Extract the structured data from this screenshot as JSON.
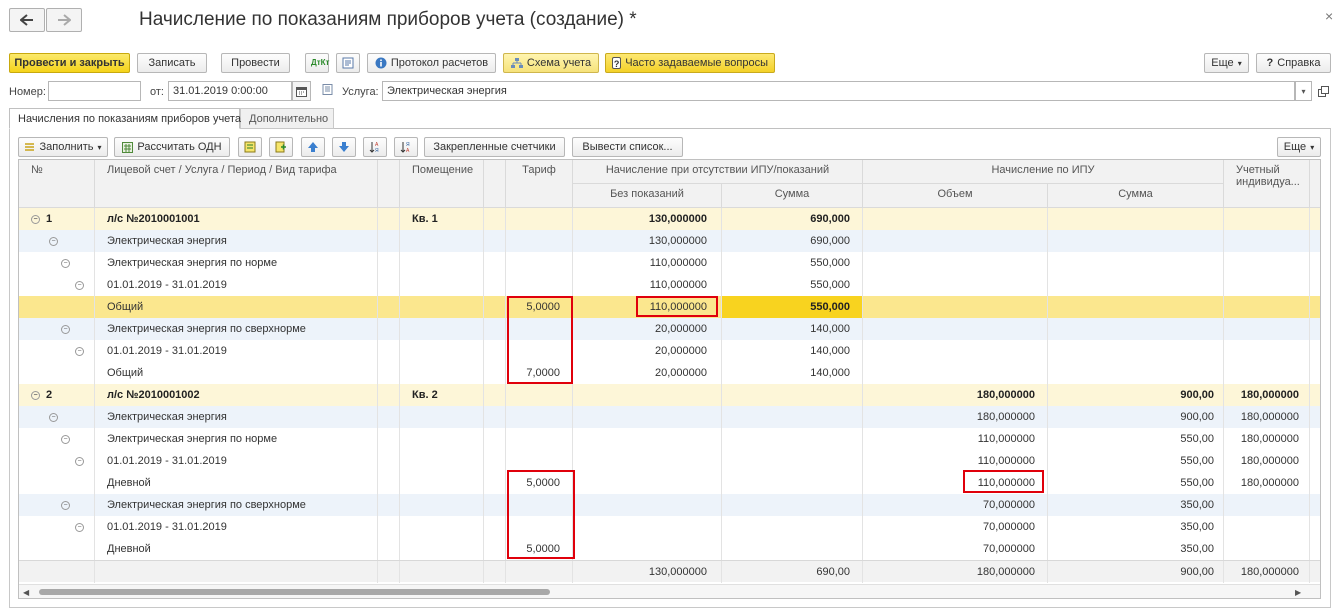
{
  "window": {
    "title": "Начисление по показаниям приборов учета (создание) *",
    "close_glyph": "×"
  },
  "toolbar": {
    "post_close": "Провести и закрыть",
    "save": "Записать",
    "post": "Провести",
    "protocol": "Протокол расчетов",
    "scheme": "Схема учета",
    "faq": "Часто задаваемые вопросы",
    "more": "Еще",
    "help": "Справка"
  },
  "form": {
    "number_label": "Номер:",
    "number_value": "",
    "date_label": "от:",
    "date_value": "31.01.2019  0:00:00",
    "service_label": "Услуга:",
    "service_value": "Электрическая энергия"
  },
  "tabs": [
    {
      "label": "Начисления по показаниям приборов учета"
    },
    {
      "label": "Дополнительно"
    }
  ],
  "table_toolbar": {
    "fill": "Заполнить",
    "calc": "Рассчитать ОДН",
    "fixed_meters": "Закрепленные счетчики",
    "output_list": "Вывести список...",
    "more": "Еще"
  },
  "columns": {
    "num": "№",
    "account": "Лицевой счет / Услуга / Период / Вид тарифа",
    "premises": "Помещение",
    "tariff": "Тариф",
    "no_ipu_group": "Начисление при отсутствии ИПУ/показаний",
    "no_readings": "Без показаний",
    "sum": "Сумма",
    "ipu_group": "Начисление по ИПУ",
    "volume": "Объем",
    "sum2": "Сумма",
    "individual": "Учетный индивидуа..."
  },
  "rows": [
    {
      "level": 0,
      "num": "1",
      "name": "л/с №2010001001",
      "premises": "Кв. 1",
      "tariff": "",
      "no_vol": "130,000000",
      "no_sum": "690,000",
      "ipu_vol": "",
      "ipu_sum": "",
      "ind": "",
      "style": "group"
    },
    {
      "level": 1,
      "num": "",
      "name": "Электрическая энергия",
      "premises": "",
      "tariff": "",
      "no_vol": "130,000000",
      "no_sum": "690,000",
      "ipu_vol": "",
      "ipu_sum": "",
      "ind": "",
      "style": "blue"
    },
    {
      "level": 2,
      "num": "",
      "name": "Электрическая энергия по норме",
      "premises": "",
      "tariff": "",
      "no_vol": "110,000000",
      "no_sum": "550,000",
      "ipu_vol": "",
      "ipu_sum": "",
      "ind": "",
      "style": "white"
    },
    {
      "level": 3,
      "num": "",
      "name": "01.01.2019 - 31.01.2019",
      "premises": "",
      "tariff": "",
      "no_vol": "110,000000",
      "no_sum": "550,000",
      "ipu_vol": "",
      "ipu_sum": "",
      "ind": "",
      "style": "white"
    },
    {
      "level": 4,
      "num": "",
      "name": "Общий",
      "premises": "",
      "tariff": "5,0000",
      "no_vol": "110,000000",
      "no_sum": "550,000",
      "ipu_vol": "",
      "ipu_sum": "",
      "ind": "",
      "style": "selected"
    },
    {
      "level": 2,
      "num": "",
      "name": "Электрическая энергия по сверхнорме",
      "premises": "",
      "tariff": "",
      "no_vol": "20,000000",
      "no_sum": "140,000",
      "ipu_vol": "",
      "ipu_sum": "",
      "ind": "",
      "style": "blue"
    },
    {
      "level": 3,
      "num": "",
      "name": "01.01.2019 - 31.01.2019",
      "premises": "",
      "tariff": "",
      "no_vol": "20,000000",
      "no_sum": "140,000",
      "ipu_vol": "",
      "ipu_sum": "",
      "ind": "",
      "style": "white"
    },
    {
      "level": 4,
      "num": "",
      "name": "Общий",
      "premises": "",
      "tariff": "7,0000",
      "no_vol": "20,000000",
      "no_sum": "140,000",
      "ipu_vol": "",
      "ipu_sum": "",
      "ind": "",
      "style": "white"
    },
    {
      "level": 0,
      "num": "2",
      "name": "л/с №2010001002",
      "premises": "Кв. 2",
      "tariff": "",
      "no_vol": "",
      "no_sum": "",
      "ipu_vol": "180,000000",
      "ipu_sum": "900,00",
      "ind": "180,000000",
      "style": "group"
    },
    {
      "level": 1,
      "num": "",
      "name": "Электрическая энергия",
      "premises": "",
      "tariff": "",
      "no_vol": "",
      "no_sum": "",
      "ipu_vol": "180,000000",
      "ipu_sum": "900,00",
      "ind": "180,000000",
      "style": "blue"
    },
    {
      "level": 2,
      "num": "",
      "name": "Электрическая энергия по норме",
      "premises": "",
      "tariff": "",
      "no_vol": "",
      "no_sum": "",
      "ipu_vol": "110,000000",
      "ipu_sum": "550,00",
      "ind": "180,000000",
      "style": "white"
    },
    {
      "level": 3,
      "num": "",
      "name": "01.01.2019 - 31.01.2019",
      "premises": "",
      "tariff": "",
      "no_vol": "",
      "no_sum": "",
      "ipu_vol": "110,000000",
      "ipu_sum": "550,00",
      "ind": "180,000000",
      "style": "white"
    },
    {
      "level": 4,
      "num": "",
      "name": "Дневной",
      "premises": "",
      "tariff": "5,0000",
      "no_vol": "",
      "no_sum": "",
      "ipu_vol": "110,000000",
      "ipu_sum": "550,00",
      "ind": "180,000000",
      "style": "white"
    },
    {
      "level": 2,
      "num": "",
      "name": "Электрическая энергия по сверхнорме",
      "premises": "",
      "tariff": "",
      "no_vol": "",
      "no_sum": "",
      "ipu_vol": "70,000000",
      "ipu_sum": "350,00",
      "ind": "",
      "style": "blue"
    },
    {
      "level": 3,
      "num": "",
      "name": "01.01.2019 - 31.01.2019",
      "premises": "",
      "tariff": "",
      "no_vol": "",
      "no_sum": "",
      "ipu_vol": "70,000000",
      "ipu_sum": "350,00",
      "ind": "",
      "style": "white"
    },
    {
      "level": 4,
      "num": "",
      "name": "Дневной",
      "premises": "",
      "tariff": "5,0000",
      "no_vol": "",
      "no_sum": "",
      "ipu_vol": "70,000000",
      "ipu_sum": "350,00",
      "ind": "",
      "style": "white"
    }
  ],
  "totals": {
    "no_vol": "130,000000",
    "no_sum": "690,00",
    "ipu_vol": "180,000000",
    "ipu_sum": "900,00",
    "ind": "180,000000"
  },
  "colors": {
    "accent": "#f5d31a",
    "group_row": "#fdf6d8",
    "selected_row": "#fbe78e",
    "selected_cell": "#f8d31f",
    "blue_row": "#edf3fa",
    "highlight_border": "#e0000b"
  }
}
